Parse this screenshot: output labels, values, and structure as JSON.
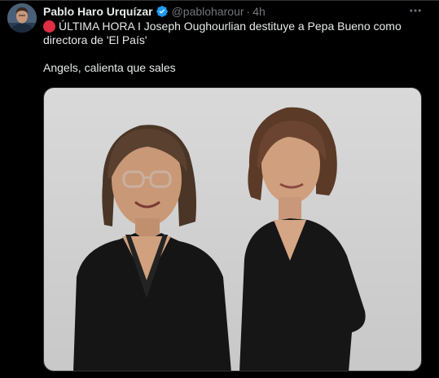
{
  "tweet": {
    "author_name": "Pablo Haro Urquízar",
    "handle": "@pabloharour",
    "separator": "·",
    "time": "4h",
    "text_line1": "ÚLTIMA HORA I Joseph Oughourlian destituye a Pepa Bueno como",
    "text_line2": "directora de 'El País'",
    "text_line3": "Angels, calienta que sales"
  },
  "icons": {
    "verified": "verified-badge-icon",
    "more": "more-options-icon",
    "breaking": "red-circle-icon"
  },
  "colors": {
    "background": "#000000",
    "text": "#e7e9ea",
    "muted": "#71767b",
    "verified_blue": "#1d9bf0",
    "red_circle": "#dd2e44"
  }
}
